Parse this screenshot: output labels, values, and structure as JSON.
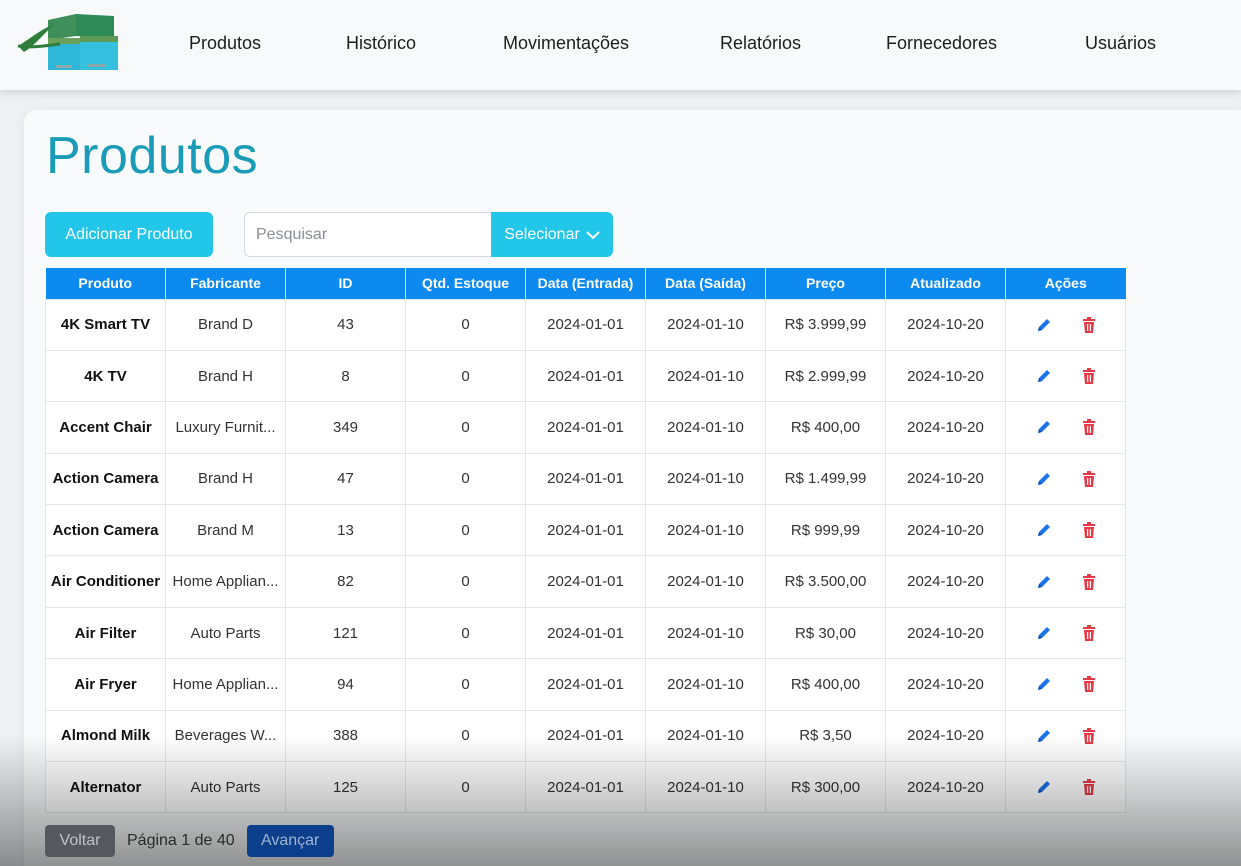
{
  "nav": {
    "logo_icon": "box-logo-icon",
    "items": [
      "Produtos",
      "Histórico",
      "Movimentações",
      "Relatórios",
      "Fornecedores",
      "Usuários"
    ]
  },
  "page": {
    "title": "Produtos",
    "add_button": "Adicionar Produto",
    "search_placeholder": "Pesquisar",
    "select_button": "Selecionar",
    "select_icon": "chevron-down-icon"
  },
  "table": {
    "headers": [
      "Produto",
      "Fabricante",
      "ID",
      "Qtd. Estoque",
      "Data (Entrada)",
      "Data (Saída)",
      "Preço",
      "Atualizado",
      "Ações"
    ],
    "rows": [
      [
        "4K Smart TV",
        "Brand D",
        "43",
        "0",
        "2024-01-01",
        "2024-01-10",
        "R$ 3.999,99",
        "2024-10-20"
      ],
      [
        "4K TV",
        "Brand H",
        "8",
        "0",
        "2024-01-01",
        "2024-01-10",
        "R$ 2.999,99",
        "2024-10-20"
      ],
      [
        "Accent Chair",
        "Luxury Furnit...",
        "349",
        "0",
        "2024-01-01",
        "2024-01-10",
        "R$ 400,00",
        "2024-10-20"
      ],
      [
        "Action Camera",
        "Brand H",
        "47",
        "0",
        "2024-01-01",
        "2024-01-10",
        "R$ 1.499,99",
        "2024-10-20"
      ],
      [
        "Action Camera",
        "Brand M",
        "13",
        "0",
        "2024-01-01",
        "2024-01-10",
        "R$ 999,99",
        "2024-10-20"
      ],
      [
        "Air Conditioner",
        "Home Applian...",
        "82",
        "0",
        "2024-01-01",
        "2024-01-10",
        "R$ 3.500,00",
        "2024-10-20"
      ],
      [
        "Air Filter",
        "Auto Parts",
        "121",
        "0",
        "2024-01-01",
        "2024-01-10",
        "R$ 30,00",
        "2024-10-20"
      ],
      [
        "Air Fryer",
        "Home Applian...",
        "94",
        "0",
        "2024-01-01",
        "2024-01-10",
        "R$ 400,00",
        "2024-10-20"
      ],
      [
        "Almond Milk",
        "Beverages W...",
        "388",
        "0",
        "2024-01-01",
        "2024-01-10",
        "R$ 3,50",
        "2024-10-20"
      ],
      [
        "Alternator",
        "Auto Parts",
        "125",
        "0",
        "2024-01-01",
        "2024-01-10",
        "R$ 300,00",
        "2024-10-20"
      ]
    ],
    "action_icons": [
      "pencil-edit-icon",
      "trash-delete-icon"
    ]
  },
  "pagination": {
    "prev": "Voltar",
    "info": "Página 1 de 40",
    "next": "Avançar"
  },
  "colors": {
    "accent": "#22c6e8",
    "title": "#1a9cb8",
    "table_header": "#0d8af0",
    "edit_icon": "#1a73e8",
    "delete_icon": "#e53945"
  }
}
